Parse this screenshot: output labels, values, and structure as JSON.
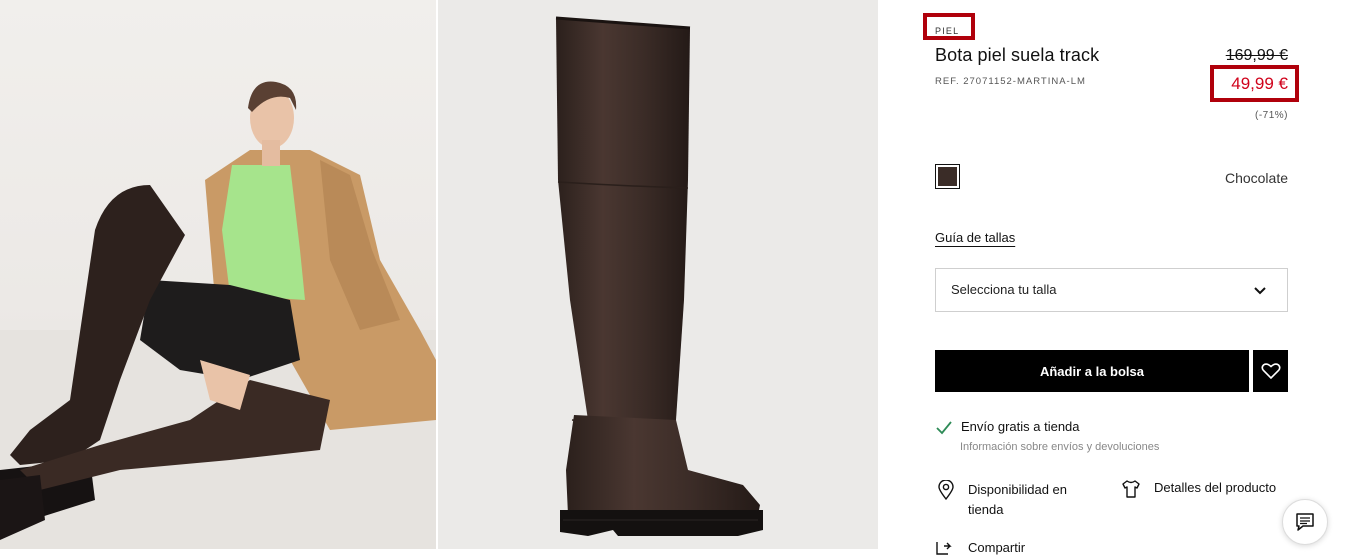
{
  "gallery": {
    "model_photo_alt": "",
    "product_photo_alt": ""
  },
  "product": {
    "tag": "PIEL",
    "title": "Bota piel suela track",
    "ref": "REF. 27071152-MARTINA-LM",
    "old_price": "169,99 €",
    "new_price": "49,99 €",
    "discount": "(-71%)",
    "color_name": "Chocolate",
    "swatch_color": "#3a2c27",
    "sale_color": "#d0021b",
    "highlight_color": "#b0000b"
  },
  "size": {
    "guide_label": "Guía de tallas",
    "select_placeholder": "Selecciona tu talla"
  },
  "actions": {
    "add_to_bag": "Añadir a la bolsa"
  },
  "shipping": {
    "title": "Envío gratis a tienda",
    "link": "Información sobre envíos y devoluciones"
  },
  "extras": {
    "availability": "Disponibilidad en tienda",
    "details": "Detalles del producto",
    "next_item": "Compartir"
  }
}
